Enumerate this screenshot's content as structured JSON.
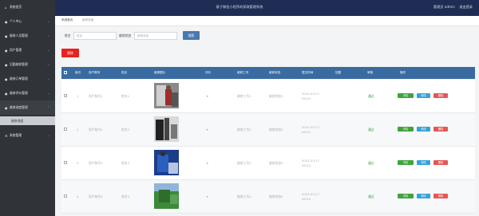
{
  "app": {
    "title": "基于微信小程序的家政管理系统",
    "user_label": "管理员 admin",
    "logout": "退出登录"
  },
  "sidebar": {
    "items": [
      {
        "label": "系统首页",
        "icon": "home-icon"
      },
      {
        "label": "个人中心",
        "icon": "user-icon"
      },
      {
        "label": "维修人员管理",
        "icon": "worker-icon"
      },
      {
        "label": "用户管理",
        "icon": "users-icon"
      },
      {
        "label": "后勤维修管理",
        "icon": "wrench-icon"
      },
      {
        "label": "维修订单管理",
        "icon": "order-icon"
      },
      {
        "label": "维修评价管理",
        "icon": "star-icon"
      },
      {
        "label": "维修进度管理",
        "icon": "progress-icon"
      },
      {
        "label": "系统管理",
        "icon": "gear-icon"
      }
    ],
    "active_sub": "维修进度"
  },
  "tabs": {
    "home": "系统首页",
    "current": "维修进度"
  },
  "search": {
    "label1": "姓名",
    "placeholder1": "姓名",
    "label2": "维修状态",
    "placeholder2": "维修状态",
    "button": "搜索"
  },
  "toolbar": {
    "delete_label": "删除"
  },
  "table": {
    "headers": [
      "索引",
      "用户账号",
      "姓名",
      "维修图片",
      "评价",
      "维修工号",
      "维修状态",
      "提交时间",
      "回复",
      "审核",
      "操作"
    ],
    "rows": [
      {
        "index": "1",
        "account": "用户账号1",
        "name": "姓名1",
        "rating": "★",
        "staff_id": "维修工号1",
        "state": "维修状态1",
        "time": "2021-03-17 09:24",
        "reply": "",
        "audit": "通过"
      },
      {
        "index": "2",
        "account": "用户账号2",
        "name": "姓名2",
        "rating": "★",
        "staff_id": "维修工号2",
        "state": "维修状态2",
        "time": "2021-03-17 09:24",
        "reply": "",
        "audit": "通过"
      },
      {
        "index": "3",
        "account": "用户账号3",
        "name": "姓名3",
        "rating": "★",
        "staff_id": "维修工号3",
        "state": "维修状态3",
        "time": "2021-03-17 09:24",
        "reply": "",
        "audit": "通过"
      },
      {
        "index": "4",
        "account": "用户账号4",
        "name": "姓名4",
        "rating": "★",
        "staff_id": "维修工号4",
        "state": "维修状态4",
        "time": "2021-03-17 09:24",
        "reply": "",
        "audit": "通过"
      }
    ],
    "actions": {
      "view": "详情",
      "edit": "修改",
      "delete": "删除"
    }
  },
  "colors": {
    "topbar": "#1f2d54",
    "sidebar": "#303438",
    "table_header": "#3a6ba0",
    "delete": "#e8221e",
    "view": "#41a33c",
    "edit": "#36a2d8",
    "row_delete": "#e45757"
  }
}
